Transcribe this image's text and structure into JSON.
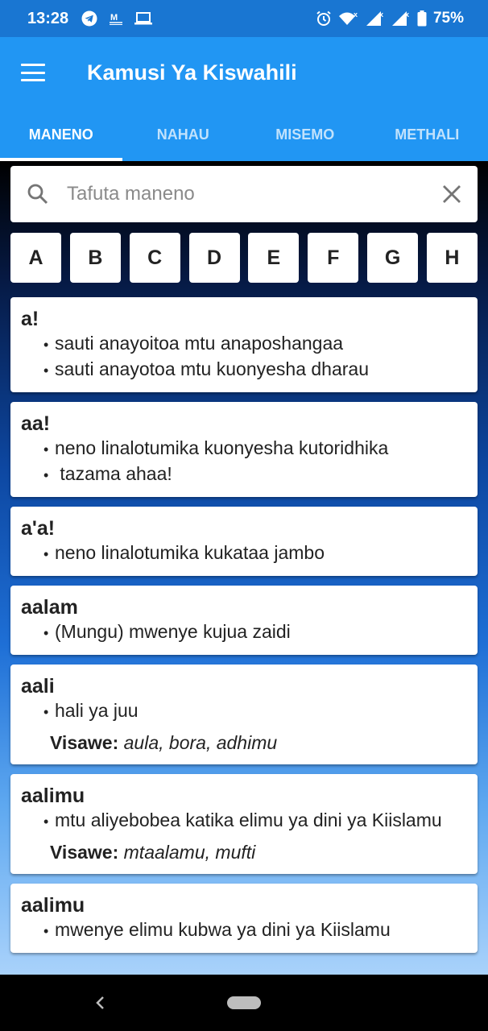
{
  "status_bar": {
    "time": "13:28",
    "battery": "75%",
    "icons": [
      "telegram-icon",
      "mail-icon",
      "laptop-icon",
      "alarm-icon",
      "wifi-icon",
      "signal-icon",
      "battery-icon"
    ]
  },
  "app_bar": {
    "title": "Kamusi Ya Kiswahili",
    "menu_icon": "menu-icon"
  },
  "tabs": [
    {
      "label": "MANENO",
      "active": true
    },
    {
      "label": "NAHAU",
      "active": false
    },
    {
      "label": "MISEMO",
      "active": false
    },
    {
      "label": "METHALI",
      "active": false
    }
  ],
  "search": {
    "placeholder": "Tafuta maneno",
    "value": ""
  },
  "letters": [
    "A",
    "B",
    "C",
    "D",
    "E",
    "F",
    "G",
    "H"
  ],
  "entries": [
    {
      "word": "a!",
      "definitions": [
        "sauti anayoitoa mtu anaposhangaa",
        "sauti anayotoa mtu kuonyesha dharau"
      ]
    },
    {
      "word": "aa!",
      "definitions": [
        "neno linalotumika kuonyesha kutoridhika",
        " tazama ahaa!"
      ]
    },
    {
      "word": "a'a!",
      "definitions": [
        "neno linalotumika kukataa jambo"
      ]
    },
    {
      "word": "aalam",
      "definitions": [
        "(Mungu) mwenye kujua zaidi"
      ]
    },
    {
      "word": "aali",
      "definitions": [
        "hali ya juu"
      ],
      "synonyms_label": "Visawe:",
      "synonyms": "aula, bora, adhimu"
    },
    {
      "word": "aalimu",
      "definitions": [
        "mtu aliyebobea katika elimu ya dini ya Kiislamu"
      ],
      "synonyms_label": "Visawe:",
      "synonyms": "mtaalamu, mufti"
    },
    {
      "word": "aalimu",
      "definitions": [
        "mwenye elimu kubwa ya dini ya Kiislamu"
      ]
    }
  ],
  "colors": {
    "app_bar": "#2196f3",
    "status_bar": "#1976d2"
  }
}
